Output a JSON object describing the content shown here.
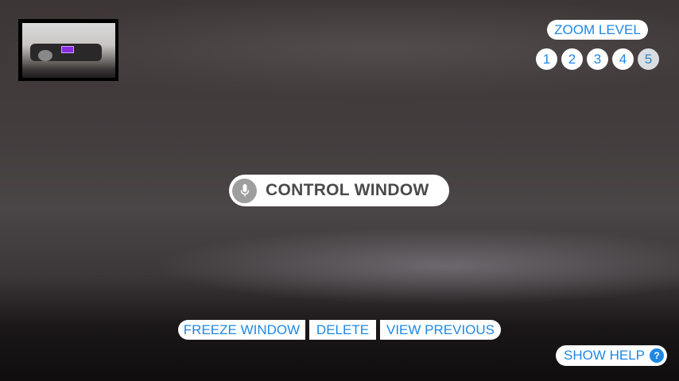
{
  "zoom": {
    "label": "ZOOM LEVEL",
    "levels": [
      "1",
      "2",
      "3",
      "4",
      "5"
    ],
    "selected": "5"
  },
  "control": {
    "label": "CONTROL WINDOW",
    "icon": "microphone-icon"
  },
  "actions": {
    "freeze": "FREEZE WINDOW",
    "delete": "DELETE",
    "previous": "VIEW PREVIOUS"
  },
  "help": {
    "label": "SHOW HELP",
    "icon_glyph": "?"
  },
  "colors": {
    "accent": "#1e88e5",
    "marker": "#8a2be2",
    "selected_level_bg": "#dadde1"
  }
}
